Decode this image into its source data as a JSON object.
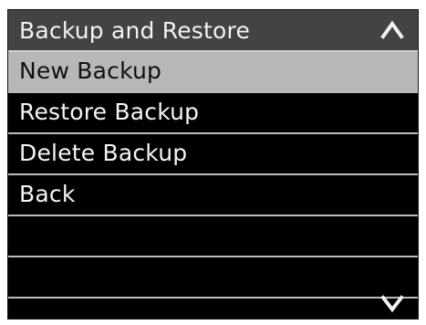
{
  "menu": {
    "title": "Backup and Restore",
    "items": [
      {
        "label": "New Backup",
        "selected": true
      },
      {
        "label": "Restore Backup",
        "selected": false
      },
      {
        "label": "Delete Backup",
        "selected": false
      },
      {
        "label": "Back",
        "selected": false
      }
    ],
    "empty_rows": 3
  },
  "icons": {
    "scroll_up": "chevron-up-icon",
    "scroll_down": "chevron-down-icon"
  },
  "colors": {
    "background": "#000000",
    "header": "#434343",
    "selected_row": "#b7b7b7",
    "divider": "#bdbdbd",
    "text": "#f5f5f5"
  }
}
